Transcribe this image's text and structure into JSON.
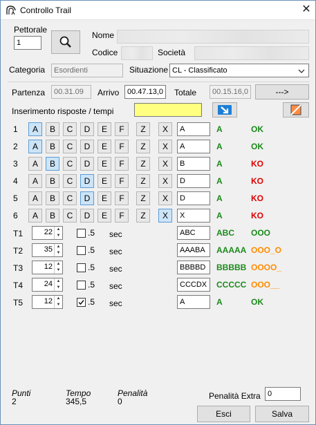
{
  "window": {
    "title": "Controllo Trail",
    "close_glyph": "✕"
  },
  "pettorale": {
    "label": "Pettorale",
    "value": "1"
  },
  "search_button_icon": "search-icon",
  "nome": {
    "label": "Nome",
    "value": ""
  },
  "codice": {
    "label": "Codice",
    "value": ""
  },
  "societa": {
    "label": "Società",
    "value": ""
  },
  "categoria": {
    "label": "Categoria",
    "value": "Esordienti"
  },
  "situazione": {
    "label": "Situazione",
    "value": "CL - Classificato"
  },
  "partenza": {
    "label": "Partenza",
    "value": "00.31.09"
  },
  "arrivo": {
    "label": "Arrivo",
    "value": "00.47.13,0"
  },
  "totale": {
    "label": "Totale",
    "value": "00.15.16,0"
  },
  "go_button": "--->",
  "inserimento": {
    "label": "Inserimento risposte / tempi",
    "value": "",
    "highlight": "#ffff80"
  },
  "option_letters": [
    "A",
    "B",
    "C",
    "D",
    "E",
    "F",
    "Z",
    "X"
  ],
  "questions": [
    {
      "num": "1",
      "selected": "A",
      "answer": "A",
      "correct": "A",
      "result": "OK",
      "status": "ok"
    },
    {
      "num": "2",
      "selected": "A",
      "answer": "A",
      "correct": "A",
      "result": "OK",
      "status": "ok"
    },
    {
      "num": "3",
      "selected": "B",
      "answer": "B",
      "correct": "A",
      "result": "KO",
      "status": "ko"
    },
    {
      "num": "4",
      "selected": "D",
      "answer": "D",
      "correct": "A",
      "result": "KO",
      "status": "ko"
    },
    {
      "num": "5",
      "selected": "D",
      "answer": "D",
      "correct": "A",
      "result": "KO",
      "status": "ko"
    },
    {
      "num": "6",
      "selected": "X",
      "answer": "X",
      "correct": "A",
      "result": "KO",
      "status": "ko"
    }
  ],
  "timed": [
    {
      "num": "T1",
      "value": "22",
      "half": false,
      "half_label": ".5",
      "unit": "sec",
      "answer": "ABC",
      "correct": "ABC",
      "result": "OOO",
      "status": "ok"
    },
    {
      "num": "T2",
      "value": "35",
      "half": false,
      "half_label": ".5",
      "unit": "sec",
      "answer": "AAABA",
      "correct": "AAAAA",
      "result": "OOO_O",
      "status": "partial"
    },
    {
      "num": "T3",
      "value": "12",
      "half": false,
      "half_label": ".5",
      "unit": "sec",
      "answer": "BBBBD",
      "correct": "BBBBB",
      "result": "OOOO_",
      "status": "partial"
    },
    {
      "num": "T4",
      "value": "24",
      "half": false,
      "half_label": ".5",
      "unit": "sec",
      "answer": "CCCDX",
      "correct": "CCCCC",
      "result": "OOO__",
      "status": "partial"
    },
    {
      "num": "T5",
      "value": "12",
      "half": true,
      "half_label": ".5",
      "unit": "sec",
      "answer": "A",
      "correct": "A",
      "result": "OK",
      "status": "ok"
    }
  ],
  "summary": {
    "punti_label": "Punti",
    "punti": "2",
    "tempo_label": "Tempo",
    "tempo": "345,5",
    "penalita_label": "Penalità",
    "penalita": "0"
  },
  "penalita_extra": {
    "label": "Penalità Extra",
    "value": "0"
  },
  "buttons": {
    "esci": "Esci",
    "salva": "Salva"
  },
  "colors": {
    "ok": "#1b8a1b",
    "ko": "#e00000",
    "partial": "#ff8c00",
    "selected": "#cce4f7",
    "accent": "#1e7fd6"
  }
}
